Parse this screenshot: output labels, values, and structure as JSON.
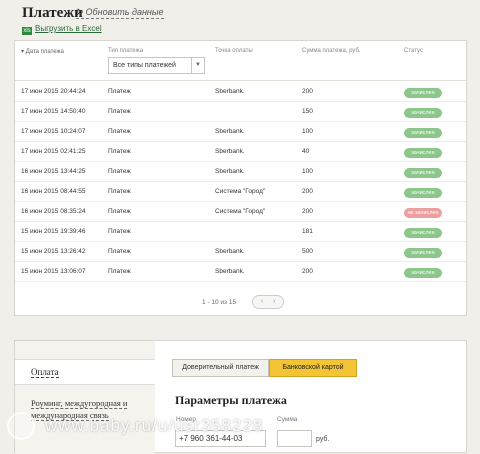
{
  "header": {
    "title": "Платежи",
    "refresh_icon": "refresh-icon",
    "refresh_label": "Обновить данные",
    "excel_icon": "excel-icon",
    "excel_icon_text": "xls",
    "excel_label": "Выгрузить в Excel"
  },
  "table": {
    "columns": [
      "Дата платежа",
      "Тип платежа",
      "Точка оплаты",
      "Сумма платежа, руб.",
      "Статус"
    ],
    "type_filter": "Все типы платежей",
    "rows": [
      {
        "date": "17 июн 2015  20:44:24",
        "type": "Платеж",
        "point": "Sberbank.",
        "amount": "200",
        "status": "зачислен"
      },
      {
        "date": "17 июн 2015  14:50:40",
        "type": "Платеж",
        "point": "",
        "amount": "150",
        "status": "зачислен"
      },
      {
        "date": "17 июн 2015  10:24:07",
        "type": "Платеж",
        "point": "Sberbank.",
        "amount": "100",
        "status": "зачислен"
      },
      {
        "date": "17 июн 2015  02:41:25",
        "type": "Платеж",
        "point": "Sberbank.",
        "amount": "40",
        "status": "зачислен"
      },
      {
        "date": "16 июн 2015  13:44:25",
        "type": "Платеж",
        "point": "Sberbank.",
        "amount": "100",
        "status": "зачислен"
      },
      {
        "date": "16 июн 2015  08:44:55",
        "type": "Платеж",
        "point": "Система \"Город\"",
        "amount": "200",
        "status": "зачислен"
      },
      {
        "date": "16 июн 2015  08:35:24",
        "type": "Платеж",
        "point": "Система \"Город\"",
        "amount": "200",
        "status": "не зачислен"
      },
      {
        "date": "15 июн 2015  19:39:46",
        "type": "Платеж",
        "point": "",
        "amount": "181",
        "status": "зачислен"
      },
      {
        "date": "15 июн 2015  13:26:42",
        "type": "Платеж",
        "point": "Sberbank.",
        "amount": "500",
        "status": "зачислен"
      },
      {
        "date": "15 июн 2015  13:06:07",
        "type": "Платеж",
        "point": "Sberbank.",
        "amount": "200",
        "status": "зачислен"
      }
    ],
    "pager_info": "1 - 10 из 15",
    "pager_prev": "‹",
    "pager_next": "›"
  },
  "colors": {
    "status_ok": "#8cc68a",
    "status_fail": "#ec9f9f",
    "active_tab": "#f3c433"
  },
  "payment": {
    "nav_items": [
      "Оплата",
      "Роуминг, междугородная и международная связь"
    ],
    "tabs": [
      "Доверительный платеж",
      "Банковской картой"
    ],
    "active_tab": "Банковской картой",
    "params_title": "Параметры платежа",
    "phone_label": "Номер",
    "phone_value": "+7 960 361-44-03",
    "sum_label": "Сумма",
    "sum_value": "",
    "currency": "руб."
  },
  "watermark": {
    "text": "www.baby.ru/u/usr358228"
  }
}
